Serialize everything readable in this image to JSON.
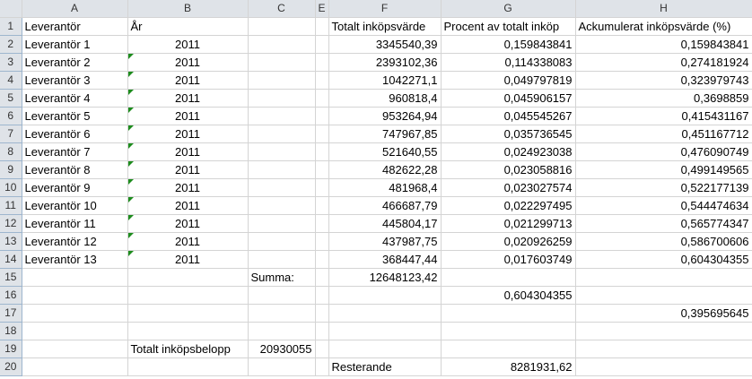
{
  "columns": [
    "A",
    "B",
    "C",
    "E",
    "F",
    "G",
    "H"
  ],
  "rows": [
    {
      "n": "1",
      "a": "Leverantör",
      "b": "År",
      "b_tri": false,
      "c": "",
      "f": "Totalt inköpsvärde",
      "g": "Procent av totalt inköp",
      "h": "Ackumulerat inköpsvärde (%)"
    },
    {
      "n": "2",
      "a": "Leverantör 1",
      "b": "2011",
      "b_tri": false,
      "c": "",
      "f": "3345540,39",
      "g": "0,159843841",
      "h": "0,159843841"
    },
    {
      "n": "3",
      "a": "Leverantör 2",
      "b": "2011",
      "b_tri": true,
      "c": "",
      "f": "2393102,36",
      "g": "0,114338083",
      "h": "0,274181924"
    },
    {
      "n": "4",
      "a": "Leverantör 3",
      "b": "2011",
      "b_tri": true,
      "c": "",
      "f": "1042271,1",
      "g": "0,049797819",
      "h": "0,323979743"
    },
    {
      "n": "5",
      "a": "Leverantör 4",
      "b": "2011",
      "b_tri": true,
      "c": "",
      "f": "960818,4",
      "g": "0,045906157",
      "h": "0,3698859"
    },
    {
      "n": "6",
      "a": "Leverantör 5",
      "b": "2011",
      "b_tri": true,
      "c": "",
      "f": "953264,94",
      "g": "0,045545267",
      "h": "0,415431167"
    },
    {
      "n": "7",
      "a": "Leverantör 6",
      "b": "2011",
      "b_tri": true,
      "c": "",
      "f": "747967,85",
      "g": "0,035736545",
      "h": "0,451167712"
    },
    {
      "n": "8",
      "a": "Leverantör 7",
      "b": "2011",
      "b_tri": true,
      "c": "",
      "f": "521640,55",
      "g": "0,024923038",
      "h": "0,476090749"
    },
    {
      "n": "9",
      "a": "Leverantör 8",
      "b": "2011",
      "b_tri": true,
      "c": "",
      "f": "482622,28",
      "g": "0,023058816",
      "h": "0,499149565"
    },
    {
      "n": "10",
      "a": "Leverantör 9",
      "b": "2011",
      "b_tri": true,
      "c": "",
      "f": "481968,4",
      "g": "0,023027574",
      "h": "0,522177139"
    },
    {
      "n": "11",
      "a": "Leverantör 10",
      "b": "2011",
      "b_tri": true,
      "c": "",
      "f": "466687,79",
      "g": "0,022297495",
      "h": "0,544474634"
    },
    {
      "n": "12",
      "a": "Leverantör 11",
      "b": "2011",
      "b_tri": true,
      "c": "",
      "f": "445804,17",
      "g": "0,021299713",
      "h": "0,565774347"
    },
    {
      "n": "13",
      "a": "Leverantör 12",
      "b": "2011",
      "b_tri": true,
      "c": "",
      "f": "437987,75",
      "g": "0,020926259",
      "h": "0,586700606"
    },
    {
      "n": "14",
      "a": "Leverantör 13",
      "b": "2011",
      "b_tri": true,
      "c": "",
      "f": "368447,44",
      "g": "0,017603749",
      "h": "0,604304355"
    },
    {
      "n": "15",
      "a": "",
      "b": "",
      "b_tri": false,
      "c": "Summa:",
      "f": "12648123,42",
      "g": "",
      "h": ""
    },
    {
      "n": "16",
      "a": "",
      "b": "",
      "b_tri": false,
      "c": "",
      "f": "",
      "g": "0,604304355",
      "h": ""
    },
    {
      "n": "17",
      "a": "",
      "b": "",
      "b_tri": false,
      "c": "",
      "f": "",
      "g": "",
      "h": "0,395695645"
    },
    {
      "n": "18",
      "a": "",
      "b": "",
      "b_tri": false,
      "c": "",
      "f": "",
      "g": "",
      "h": ""
    },
    {
      "n": "19",
      "a": "",
      "b": "Totalt inköpsbelopp",
      "b_tri": false,
      "c": "20930055",
      "f": "",
      "g": "",
      "h": ""
    },
    {
      "n": "20",
      "a": "",
      "b": "",
      "b_tri": false,
      "c": "",
      "f": "Resterande",
      "g": "8281931,62",
      "h": ""
    }
  ]
}
